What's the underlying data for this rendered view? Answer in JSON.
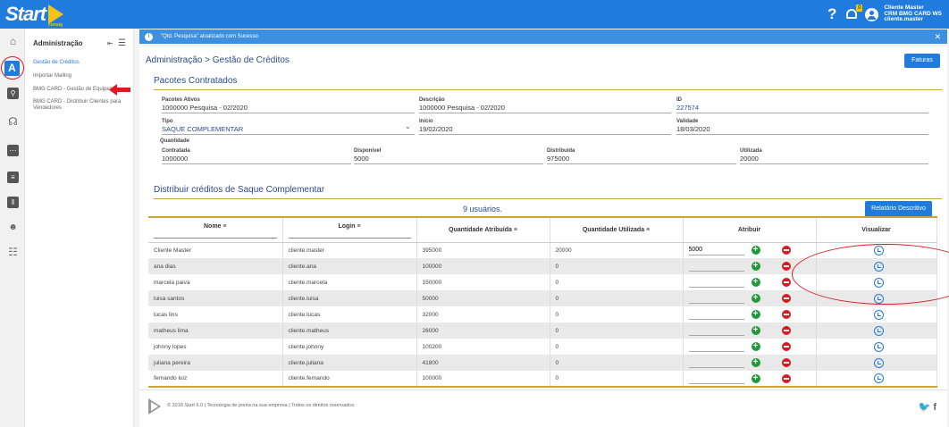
{
  "topbar": {
    "logo_text": "Start",
    "logo_sub": "consig",
    "help_glyph": "?",
    "notification_count": "0",
    "user": {
      "name": "Cliente Master",
      "org": "CRM BMG CARD WS",
      "login": "cliente.master"
    }
  },
  "rail_icons": [
    "home-icon",
    "admin-icon",
    "search-icon",
    "headset-icon",
    "chat-icon",
    "message-icon",
    "chart-icon",
    "users-icon",
    "cart-icon"
  ],
  "sidebar": {
    "title": "Administração",
    "items": [
      {
        "label": "Gestão de Créditos"
      },
      {
        "label": "Importar Mailing"
      },
      {
        "label": "BMG CARD - Gestão de Equipes"
      },
      {
        "label": "BMG CARD - Distribuir Clientes para Vendedores"
      }
    ]
  },
  "toast": {
    "message": "\"Qtd. Pesquisa\" atualizado com Sucesso."
  },
  "page": {
    "breadcrumb": "Administração > Gestão de Créditos",
    "faturas_label": "Faturas"
  },
  "pacotes": {
    "title": "Pacotes Contratados",
    "pacotes_ativos": {
      "label": "Pacotes Ativos",
      "value": "1000000 Pesquisa - 02/2020"
    },
    "descricao": {
      "label": "Descrição",
      "value": "1000000 Pesquisa - 02/2020"
    },
    "id": {
      "label": "ID",
      "value": "227574"
    },
    "tipo": {
      "label": "Tipo",
      "value": "SAQUE COMPLEMENTAR"
    },
    "inicio": {
      "label": "Início",
      "value": "19/02/2020"
    },
    "validade": {
      "label": "Validade",
      "value": "18/03/2020"
    },
    "quantidade_label": "Quantidade",
    "contratada": {
      "label": "Contratada",
      "value": "1000000"
    },
    "disponivel": {
      "label": "Disponível",
      "value": "5000"
    },
    "distribuida": {
      "label": "Distribuída",
      "value": "975000"
    },
    "utilizada": {
      "label": "Utilizada",
      "value": "20000"
    }
  },
  "distribuir": {
    "title": "Distribuir créditos de Saque Complementar",
    "users_count": "9 usuários.",
    "relatorio_label": "Relatório Descritivo",
    "columns": [
      "Nome",
      "Login",
      "Quantidade Atribuída",
      "Quantidade Utilizada",
      "Atribuir",
      "Visualizar"
    ],
    "rows": [
      {
        "nome": "Cliente Master",
        "login": "cliente.master",
        "atribuida": "395000",
        "utilizada": "20000",
        "atribuir": "5000"
      },
      {
        "nome": "ana dias",
        "login": "cliente.ana",
        "atribuida": "100000",
        "utilizada": "0",
        "atribuir": ""
      },
      {
        "nome": "marcela paiva",
        "login": "cliente.marcela",
        "atribuida": "150000",
        "utilizada": "0",
        "atribuir": ""
      },
      {
        "nome": "luisa santos",
        "login": "cliente.luisa",
        "atribuida": "50000",
        "utilizada": "0",
        "atribuir": ""
      },
      {
        "nome": "lucas lins",
        "login": "cliente.lucas",
        "atribuida": "32000",
        "utilizada": "0",
        "atribuir": ""
      },
      {
        "nome": "matheus lima",
        "login": "cliente.matheus",
        "atribuida": "26000",
        "utilizada": "0",
        "atribuir": ""
      },
      {
        "nome": "johnny lopes",
        "login": "cliente.johnny",
        "atribuida": "100200",
        "utilizada": "0",
        "atribuir": ""
      },
      {
        "nome": "juliana pereira",
        "login": "cliente.juliana",
        "atribuida": "41800",
        "utilizada": "0",
        "atribuir": ""
      },
      {
        "nome": "fernando luiz",
        "login": "cliente.fernando",
        "atribuida": "100000",
        "utilizada": "0",
        "atribuir": ""
      }
    ]
  },
  "footer": {
    "text": "© 2018 Start 6.0 | Tecnologia de ponta na sua empresa | Todos os direitos reservados.",
    "social": "🐦 f"
  },
  "colors": {
    "primary": "#1f7bdc",
    "accent": "#cfa33a",
    "plus": "#1e9a3a",
    "minus": "#d81b23"
  }
}
